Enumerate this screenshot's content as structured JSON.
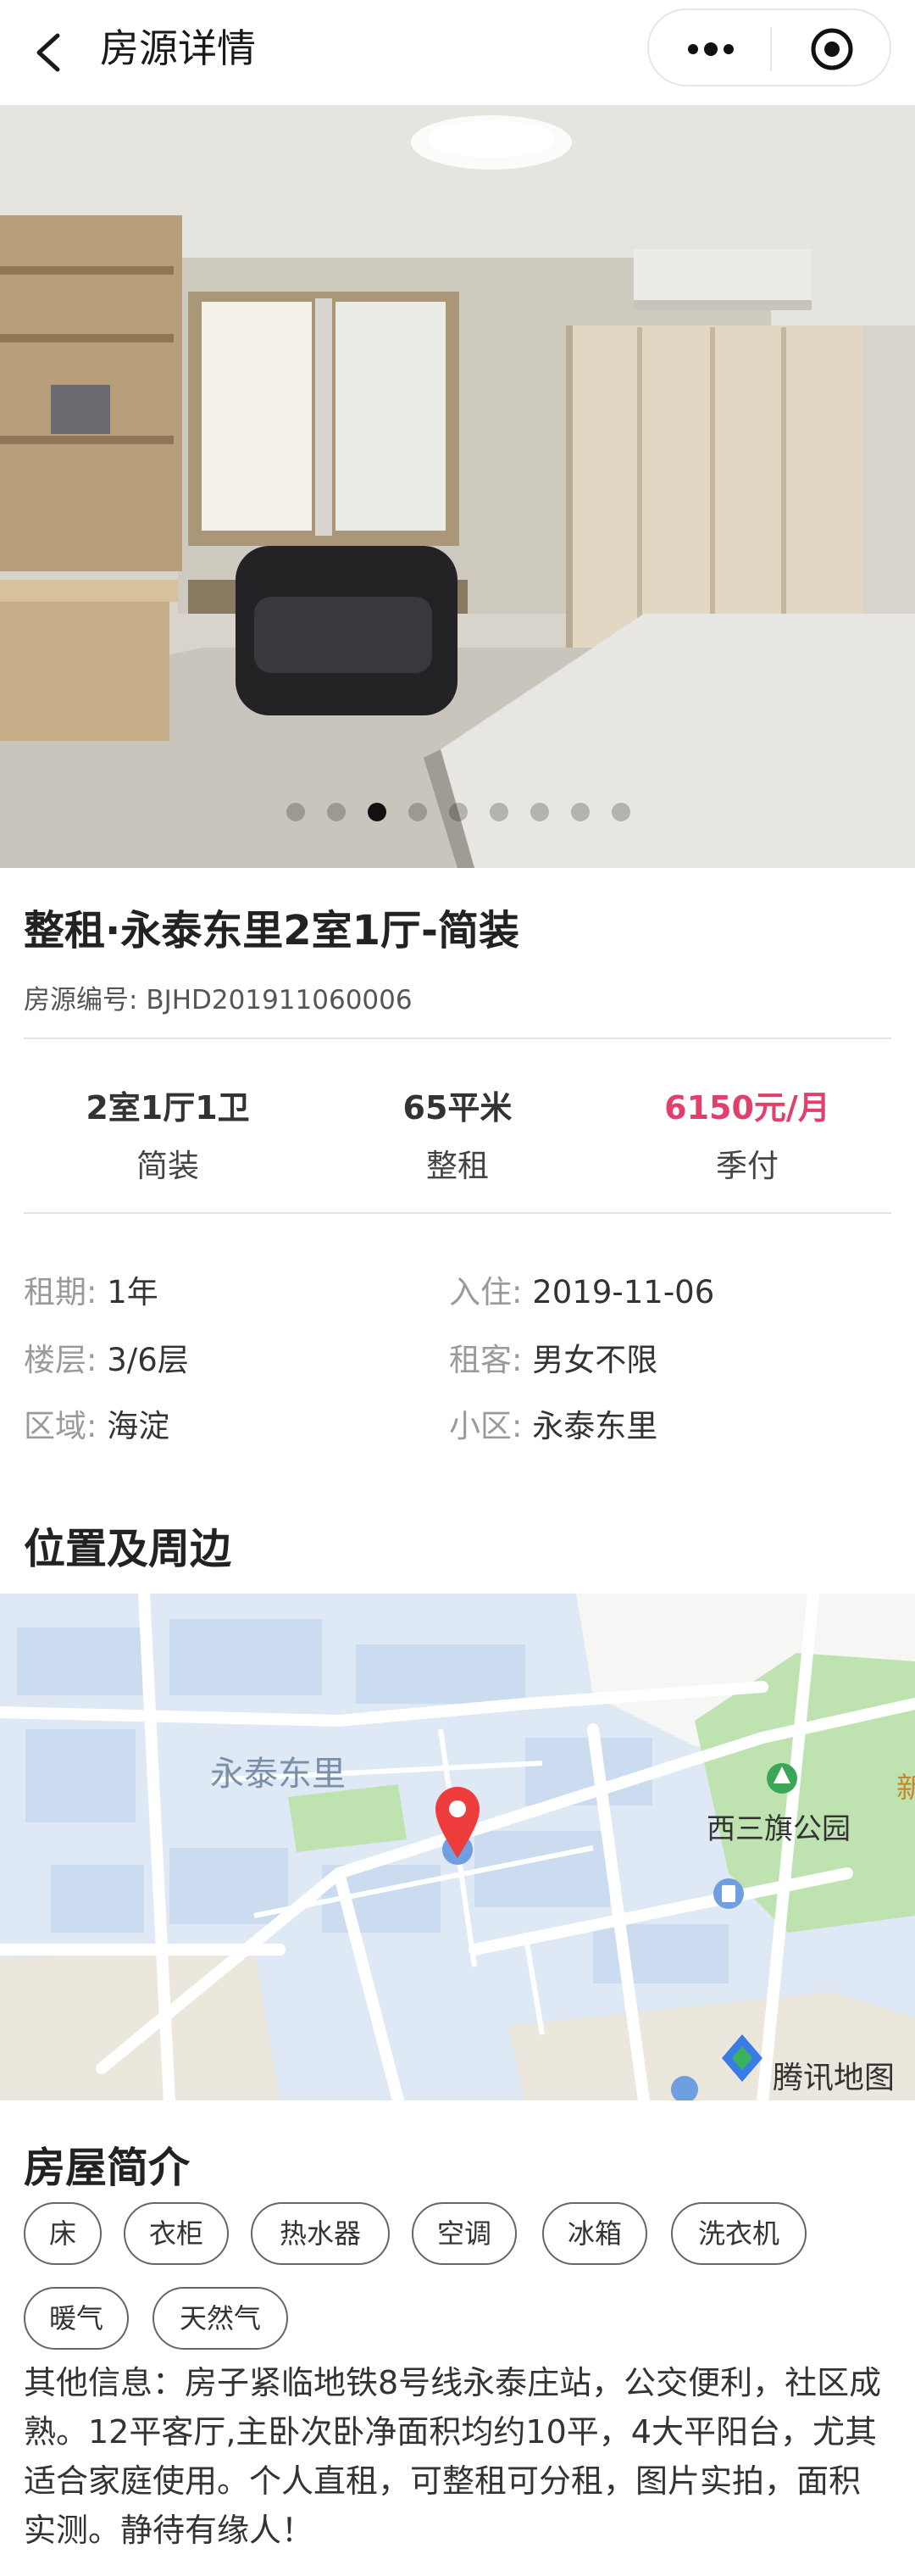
{
  "nav": {
    "title": "房源详情"
  },
  "carousel": {
    "total": 9,
    "active_index": 2
  },
  "listing": {
    "title": "整租·永泰东里2室1厅-简装",
    "code_label": "房源编号:",
    "code": "BJHD201911060006"
  },
  "stats": [
    {
      "value": "2室1厅1卫",
      "sub": "简装"
    },
    {
      "value": "65平米",
      "sub": "整租"
    },
    {
      "value": "6150元/月",
      "sub": "季付"
    }
  ],
  "price_color": "#e2406a",
  "info": {
    "lease_label": "租期:",
    "lease": "1年",
    "checkin_label": "入住:",
    "checkin": "2019-11-06",
    "floor_label": "楼层:",
    "floor": "3/6层",
    "tenant_label": "租客:",
    "tenant": "男女不限",
    "district_label": "区域:",
    "district": "海淀",
    "community_label": "小区:",
    "community": "永泰东里"
  },
  "location": {
    "heading": "位置及周边",
    "map_label_community": "永泰东里",
    "map_label_park": "西三旗公园",
    "map_label_edge": "新",
    "map_brand": "腾讯地图"
  },
  "intro": {
    "heading": "房屋简介",
    "tags": [
      "床",
      "衣柜",
      "热水器",
      "空调",
      "冰箱",
      "洗衣机",
      "暖气",
      "天然气"
    ],
    "description": "其他信息：房子紧临地铁8号线永泰庄站，公交便利，社区成熟。12平客厅,主卧次卧净面积均约10平，4大平阳台，尤其适合家庭使用。个人直租，可整租可分租，图片实拍，面积实测。静待有缘人！"
  }
}
